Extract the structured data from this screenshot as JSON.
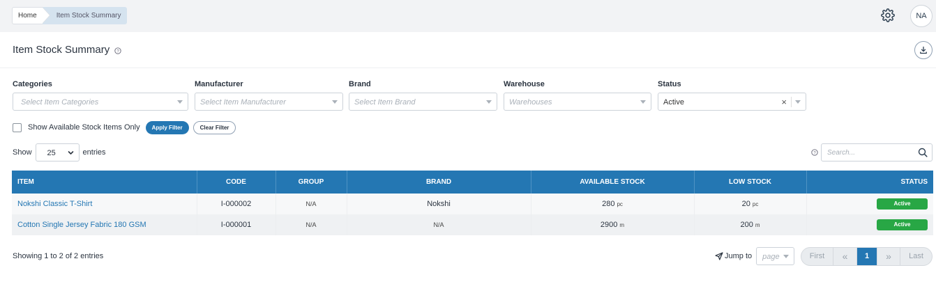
{
  "breadcrumb": {
    "home": "Home",
    "current": "Item Stock Summary"
  },
  "user": {
    "initials": "NA"
  },
  "page": {
    "title": "Item Stock Summary"
  },
  "filters": {
    "categories": {
      "label": "Categories",
      "placeholder": "Select Item Categories"
    },
    "manufacturer": {
      "label": "Manufacturer",
      "placeholder": "Select Item Manufacturer"
    },
    "brand": {
      "label": "Brand",
      "placeholder": "Select Item Brand"
    },
    "warehouse": {
      "label": "Warehouse",
      "placeholder": "Warehouses"
    },
    "status": {
      "label": "Status",
      "value": "Active"
    },
    "available_only_label": "Show Available Stock Items Only",
    "apply_label": "Apply Filter",
    "clear_label": "Clear Filter"
  },
  "length": {
    "show": "Show",
    "value": "25",
    "entries": "entries"
  },
  "search": {
    "placeholder": "Search..."
  },
  "table": {
    "columns": [
      "ITEM",
      "CODE",
      "GROUP",
      "BRAND",
      "AVAILABLE STOCK",
      "LOW STOCK",
      "STATUS"
    ],
    "rows": [
      {
        "item": "Nokshi Classic T-Shirt",
        "code": "I-000002",
        "group": "N/A",
        "brand": "Nokshi",
        "available": "280",
        "available_unit": "pc",
        "low": "20",
        "low_unit": "pc",
        "status": "Active"
      },
      {
        "item": "Cotton Single Jersey Fabric 180 GSM",
        "code": "I-000001",
        "group": "N/A",
        "brand": "N/A",
        "available": "2900",
        "available_unit": "m",
        "low": "200",
        "low_unit": "m",
        "status": "Active"
      }
    ]
  },
  "footer": {
    "info": "Showing 1 to 2 of 2 entries",
    "jump_label": "Jump to",
    "jump_placeholder": "page",
    "first": "First",
    "prev": "«",
    "page": "1",
    "next": "»",
    "last": "Last"
  },
  "colors": {
    "primary": "#2477b3",
    "success": "#28a745"
  }
}
